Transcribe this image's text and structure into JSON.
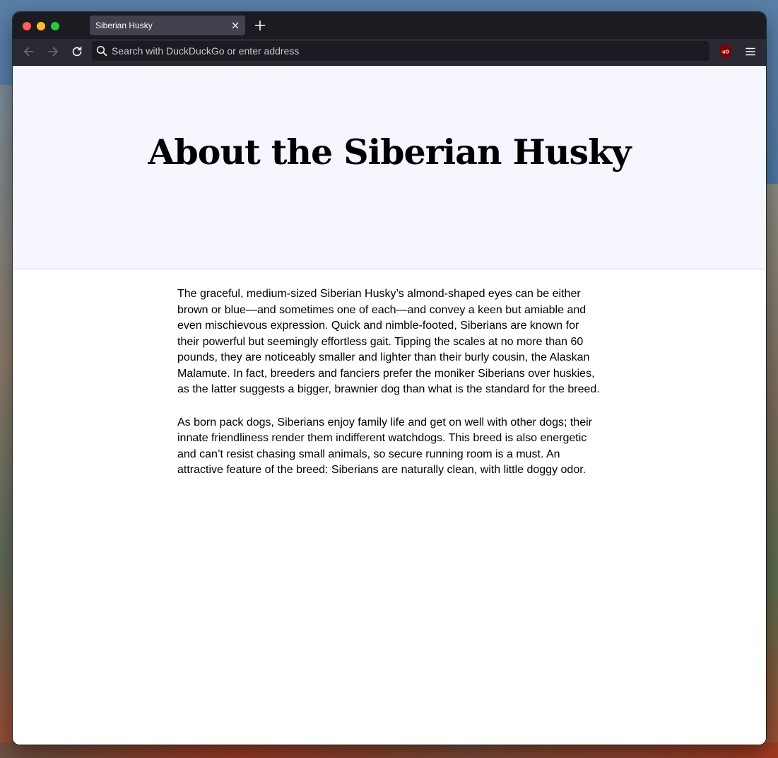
{
  "browser": {
    "tab_title": "Siberian Husky",
    "address_placeholder": "Search with DuckDuckGo or enter address",
    "extension_badge": "uO"
  },
  "icons": {
    "back": "arrow-left-icon",
    "forward": "arrow-right-icon",
    "reload": "reload-icon",
    "search": "search-icon",
    "tab_close": "close-icon",
    "new_tab": "plus-icon",
    "extension": "ublock-origin-icon",
    "menu": "hamburger-menu-icon"
  },
  "colors": {
    "titlebar": "#1c1b22",
    "toolbar": "#2b2a33",
    "hero_background": "#f5f6ff",
    "text": "#000000"
  },
  "page": {
    "title": "About the Siberian Husky",
    "paragraphs": [
      "The graceful, medium-sized Siberian Husky’s almond-shaped eyes can be either brown or blue—and sometimes one of each—and convey a keen but amiable and even mischievous expression. Quick and nimble-footed, Siberians are known for their powerful but seemingly effortless gait. Tipping the scales at no more than 60 pounds, they are noticeably smaller and lighter than their burly cousin, the Alaskan Malamute. In fact, breeders and fanciers prefer the moniker Siberians over huskies, as the latter suggests a bigger, brawnier dog than what is the standard for the breed.",
      "As born pack dogs, Siberians enjoy family life and get on well with other dogs; their innate friendliness render them indifferent watchdogs. This breed is also energetic and can’t resist chasing small animals, so secure running room is a must. An attractive feature of the breed: Siberians are naturally clean, with little doggy odor."
    ]
  }
}
